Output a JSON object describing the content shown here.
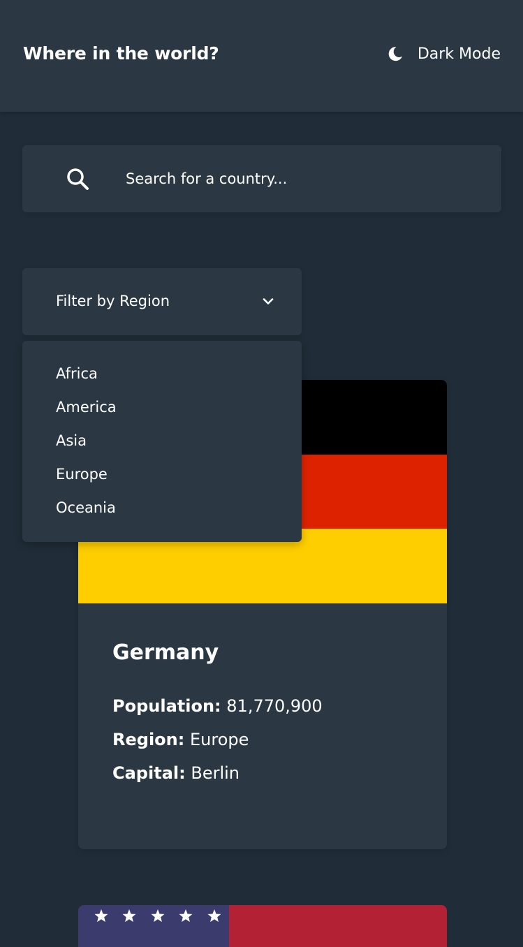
{
  "header": {
    "title": "Where in the world?",
    "theme_toggle": {
      "label": "Dark Mode",
      "icon": "moon-icon"
    }
  },
  "search": {
    "placeholder": "Search for a country...",
    "icon": "search-icon"
  },
  "filter": {
    "label": "Filter by Region",
    "icon": "chevron-down-icon",
    "open": true,
    "options": [
      "Africa",
      "America",
      "Asia",
      "Europe",
      "Oceania"
    ]
  },
  "countries": [
    {
      "name": "Germany",
      "flag": "germany-flag",
      "population_label": "Population:",
      "population": "81,770,900",
      "region_label": "Region:",
      "region": "Europe",
      "capital_label": "Capital:",
      "capital": "Berlin"
    },
    {
      "flag": "united-states-flag"
    }
  ],
  "colors": {
    "background": "#202c37",
    "surface": "#2b3743",
    "text": "#ffffff",
    "flag_black": "#000000",
    "flag_red": "#dd0000",
    "flag_gold": "#ffce00",
    "us_blue": "#3c3b6e",
    "us_red": "#b22234"
  }
}
